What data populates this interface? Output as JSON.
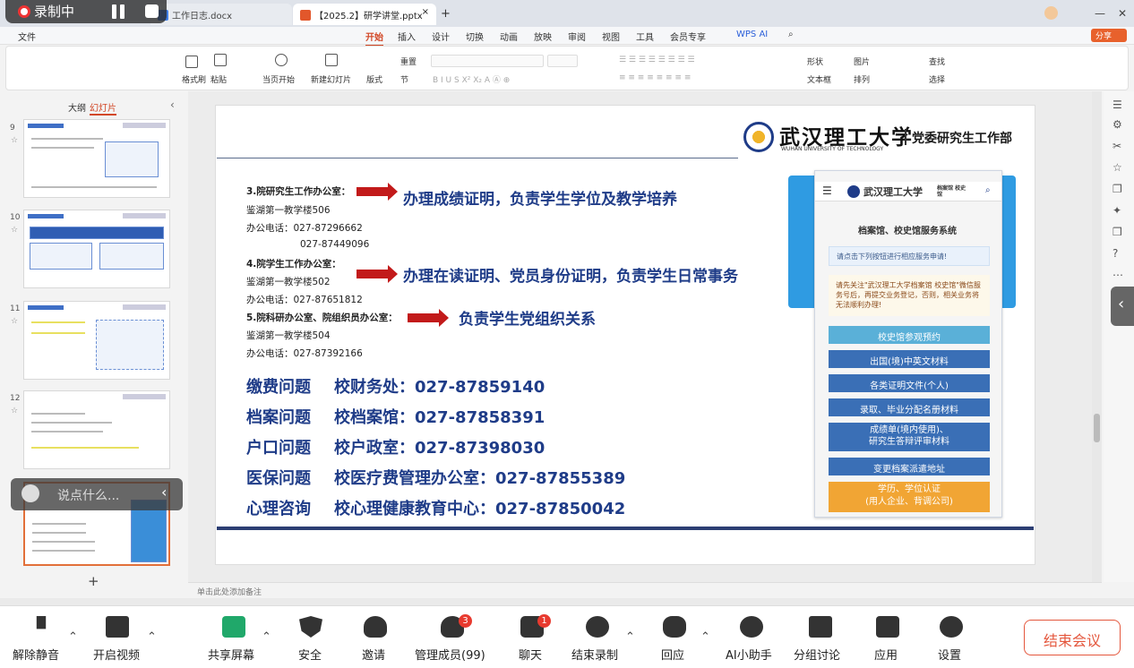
{
  "recording": {
    "label": "录制中"
  },
  "tabs": [
    {
      "label": "工作日志.docx"
    },
    {
      "label": "【2025.2】研学讲堂.pptx"
    }
  ],
  "menu": {
    "file": "文件",
    "items": [
      "开始",
      "插入",
      "设计",
      "切换",
      "动画",
      "放映",
      "审阅",
      "视图",
      "工具",
      "会员专享"
    ],
    "wps_ai": "WPS AI",
    "share": "分享"
  },
  "ribbon": {
    "format_brush": "格式刷",
    "paste": "粘贴",
    "play_current": "当页开始",
    "new_slide": "新建幻灯片",
    "layout": "版式",
    "section": "节",
    "reset": "重置",
    "shape": "形状",
    "picture": "图片",
    "find": "查找",
    "textbox": "文本框",
    "arrange": "排列",
    "select": "选择"
  },
  "left_panel": {
    "tab_outline": "大纲",
    "tab_slides": "幻灯片",
    "slide_numbers": [
      "9",
      "10",
      "11",
      "12"
    ],
    "add_label": "+"
  },
  "chat_overlay": {
    "placeholder": "说点什么..."
  },
  "slide": {
    "org_name": "武汉理工大学",
    "org_en": "WUHAN UNIVERSITY OF TECHNOLOGY",
    "dept": "党委研究生工作部",
    "items": [
      {
        "office": "3.院研究生工作办公室：",
        "location": "鉴湖第一教学楼506",
        "phone": "办公电话：027-87296662",
        "phone2": "027-87449096",
        "duty": "办理成绩证明，负责学生学位及教学培养"
      },
      {
        "office": "4.院学生工作办公室：",
        "location": "鉴湖第一教学楼502",
        "phone": "办公电话：027-87651812",
        "duty": "办理在读证明、党员身份证明，负责学生日常事务"
      },
      {
        "office": "5.院科研办公室、院组织员办公室：",
        "location": "鉴湖第一教学楼504",
        "phone": "办公电话：027-87392166",
        "duty": "负责学生党组织关系"
      }
    ],
    "contacts": [
      {
        "topic": "缴费问题",
        "dept": "校财务处：027-87859140"
      },
      {
        "topic": "档案问题",
        "dept": "校档案馆：027-87858391"
      },
      {
        "topic": "户口问题",
        "dept": "校户政室：027-87398030"
      },
      {
        "topic": "医保问题",
        "dept": "校医疗费管理办公室：027-87855389"
      },
      {
        "topic": "心理咨询",
        "dept": "校心理健康教育中心：027-87850042"
      }
    ],
    "phone_ui": {
      "header_tag": "档案馆 校史馆",
      "title": "档案馆、校史馆服务系统",
      "notice": "请点击下列按钮进行相应服务申请!",
      "tip": "请先关注\"武汉理工大学档案馆 校史馆\"微信服务号后，再提交业务登记，否则，相关业务将无法顺利办理!",
      "buttons": [
        "校史馆参观预约",
        "出国(境)中英文材料",
        "各类证明文件(个人)",
        "录取、毕业分配名册材料",
        "成绩单(境内使用)、",
        "研究生答辩评审材料",
        "变更档案派遣地址",
        "学历、学位认证",
        "(用人企业、背调公司)"
      ]
    }
  },
  "notes": {
    "placeholder": "单击此处添加备注"
  },
  "meeting": {
    "items": [
      {
        "label": "解除静音"
      },
      {
        "label": "开启视频"
      },
      {
        "label": "共享屏幕"
      },
      {
        "label": "安全"
      },
      {
        "label": "邀请"
      },
      {
        "label": "管理成员(99)",
        "badge": "3"
      },
      {
        "label": "聊天",
        "badge": "1"
      },
      {
        "label": "结束录制"
      },
      {
        "label": "回应"
      },
      {
        "label": "AI小助手"
      },
      {
        "label": "分组讨论"
      },
      {
        "label": "应用"
      },
      {
        "label": "设置"
      }
    ],
    "end": "结束会议"
  },
  "colors": {
    "accent": "#d24726",
    "slide_blue": "#1f3c88",
    "arrow_red": "#c21a1a",
    "button_blue": "#3a6fb6",
    "end_red": "#e4573d"
  }
}
